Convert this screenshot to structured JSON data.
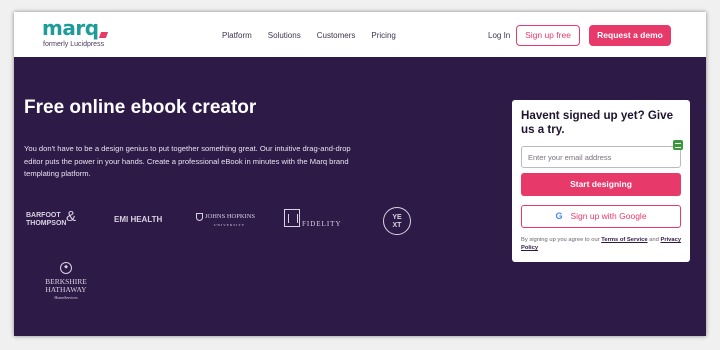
{
  "header": {
    "logo_word": "marq",
    "logo_sub": "formerly Lucidpress",
    "nav": [
      "Platform",
      "Solutions",
      "Customers",
      "Pricing"
    ],
    "login": "Log In",
    "signup": "Sign up free",
    "demo": "Request a demo"
  },
  "hero": {
    "title": "Free online ebook creator",
    "text": "You don't have to be a design genius to put together something great. Our intuitive drag-and-drop editor puts the power in your hands. Create a professional eBook in minutes with the Marq brand templating platform."
  },
  "brands": {
    "barfoot_1": "BARFOOT",
    "barfoot_2": "THOMPSON",
    "barfoot_amp": "&",
    "emi": "EMI HEALTH",
    "jh": "JOHNS HOPKINS",
    "jh_sub": "UNIVERSITY",
    "fidelity": "FIDELITY",
    "yext_1": "YE",
    "yext_2": "XT",
    "bh_1": "BERKSHIRE",
    "bh_2": "HATHAWAY",
    "bh_sub": "HomeServices"
  },
  "card": {
    "title": "Havent signed up yet? Give us a try.",
    "email_placeholder": "Enter your email address",
    "start": "Start designing",
    "google": "Sign up with Google",
    "terms_prefix": "By signing up you agree to our ",
    "terms_link": "Terms of Service",
    "terms_and": " and ",
    "privacy_link": "Privacy Policy"
  },
  "colors": {
    "accent": "#e8396b",
    "brand": "#1d9c9a",
    "background": "#2e1a47"
  }
}
